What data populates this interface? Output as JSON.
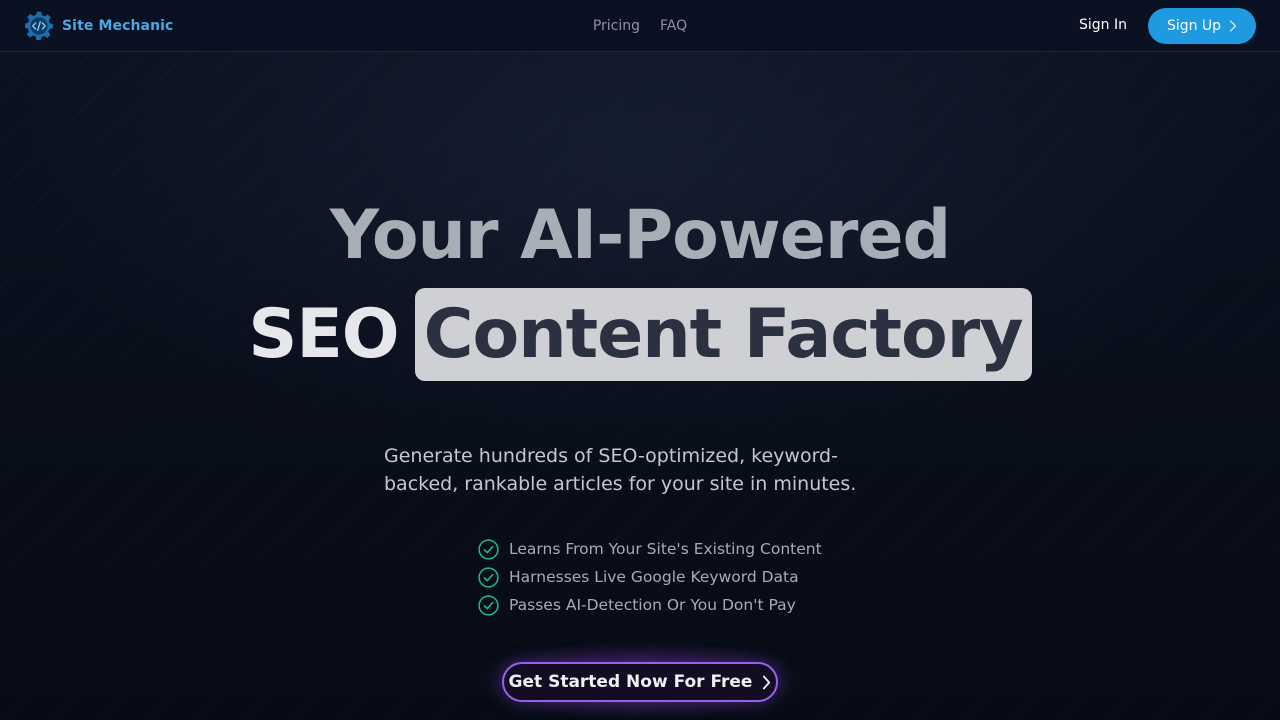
{
  "brand": {
    "name": "Site Mechanic",
    "logo_icon": "code-gear-icon"
  },
  "nav": {
    "links": [
      "Pricing",
      "FAQ"
    ],
    "sign_in": "Sign In",
    "sign_up": "Sign Up",
    "sign_up_icon": "chevron-right-icon"
  },
  "hero": {
    "headline_line1": "Your AI-Powered",
    "headline_word": "SEO",
    "headline_highlight": "Content Factory",
    "subtitle": "Generate hundreds of SEO-optimized, keyword-backed, rankable articles for your site in minutes.",
    "features": [
      "Learns From Your Site's Existing Content",
      "Harnesses Live Google Keyword Data",
      "Passes AI-Detection Or You Don't Pay"
    ],
    "feature_icon": "check-circle-icon",
    "cta_label": "Get Started Now For Free",
    "cta_icon": "chevron-right-icon"
  },
  "colors": {
    "accent": "#1e9be0",
    "brand_text": "#4aa8e6",
    "cta_border": "#9b5ff0",
    "check": "#1fb89a"
  }
}
